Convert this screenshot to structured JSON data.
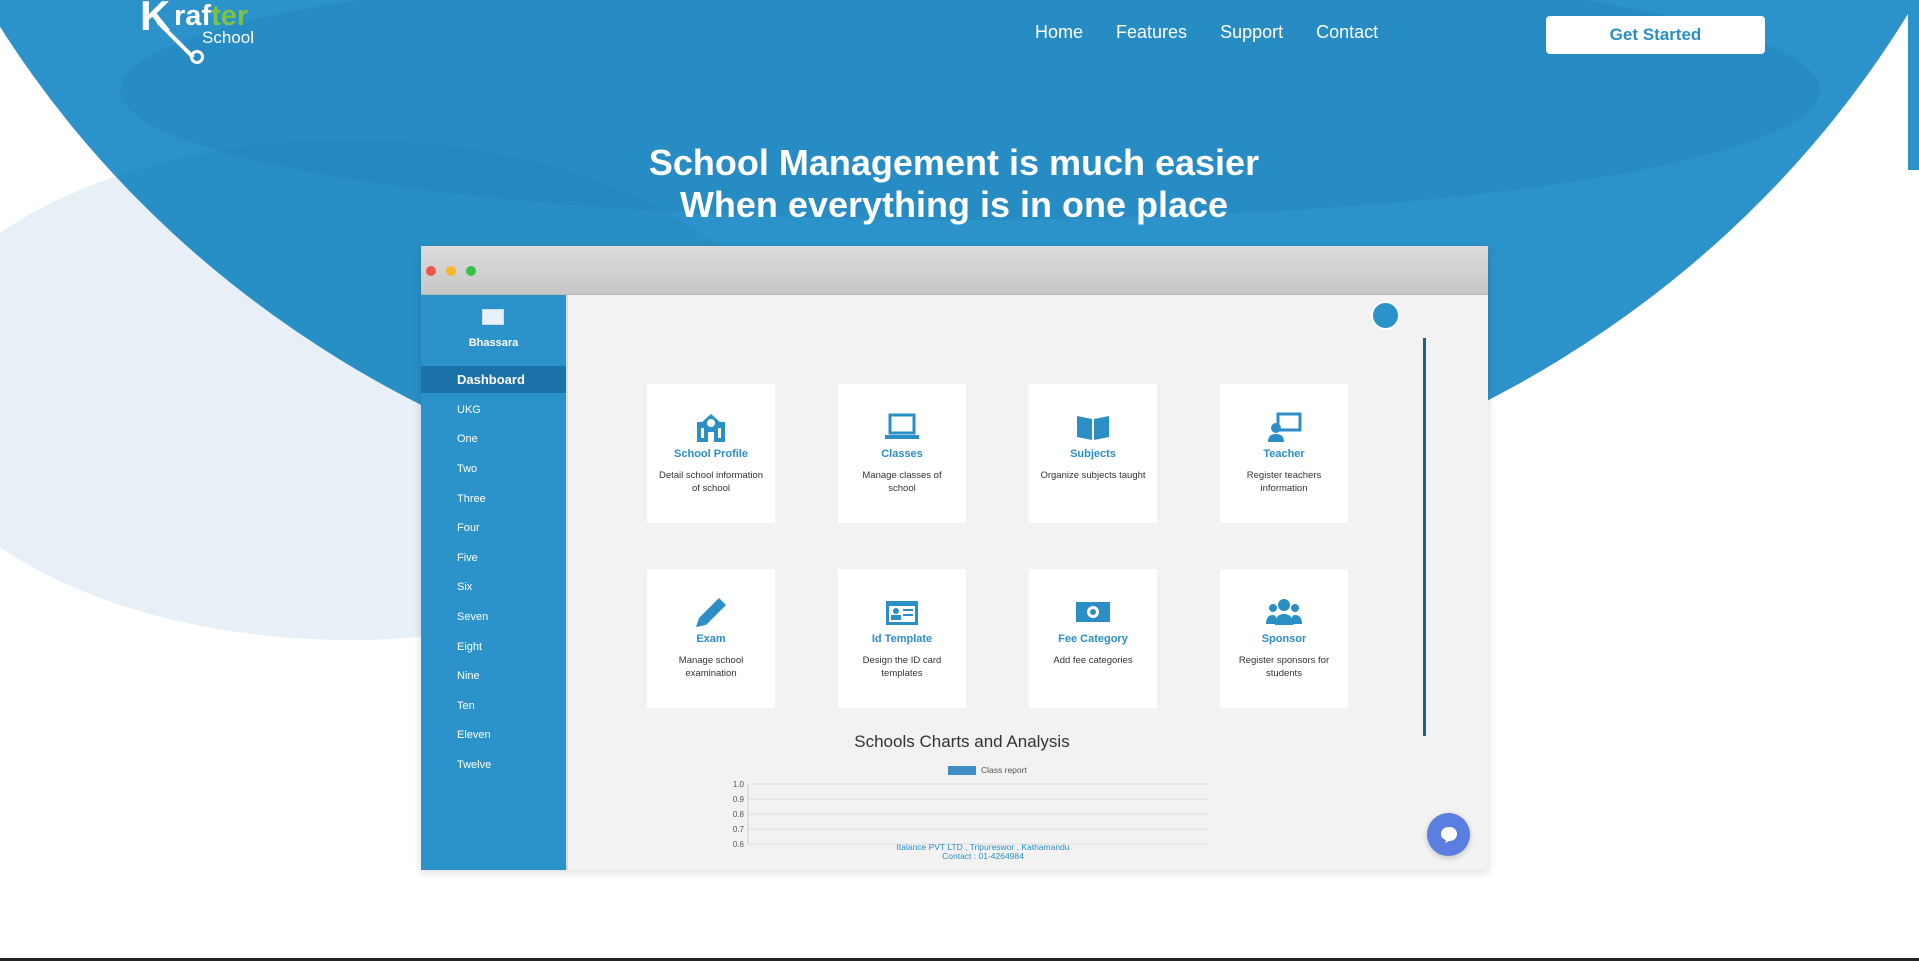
{
  "logo": {
    "k": "K",
    "rafter_white": "raf",
    "rafter_green": "ter",
    "school": "School"
  },
  "nav": {
    "links": [
      "Home",
      "Features",
      "Support",
      "Contact"
    ],
    "cta": "Get Started"
  },
  "headline": {
    "line1": "School Management is much easier",
    "line2": "When everything is in one place"
  },
  "app": {
    "school_name": "Bhassara",
    "menu": [
      "Dashboard",
      "UKG",
      "One",
      "Two",
      "Three",
      "Four",
      "Five",
      "Six",
      "Seven",
      "Eight",
      "Nine",
      "Ten",
      "Eleven",
      "Twelve"
    ],
    "cards": [
      {
        "title": "School Profile",
        "desc": "Detail school information of school",
        "icon": "school-icon"
      },
      {
        "title": "Classes",
        "desc": "Manage classes of school",
        "icon": "laptop-icon"
      },
      {
        "title": "Subjects",
        "desc": "Organize subjects taught",
        "icon": "book-icon"
      },
      {
        "title": "Teacher",
        "desc": "Register teachers information",
        "icon": "teacher-icon"
      },
      {
        "title": "Exam",
        "desc": "Manage school examination",
        "icon": "pencil-icon"
      },
      {
        "title": "Id Template",
        "desc": "Design the ID card templates",
        "icon": "id-card-icon"
      },
      {
        "title": "Fee Category",
        "desc": "Add fee categories",
        "icon": "money-icon"
      },
      {
        "title": "Sponsor",
        "desc": "Register sponsors for students",
        "icon": "users-icon"
      }
    ],
    "charts_title": "Schools Charts and Analysis",
    "footer_line1": "Italance PVT LTD , Tripureswor , Kathamandu",
    "footer_line2": "Contact : 01-4264984"
  },
  "chart_data": {
    "type": "bar",
    "series": [
      {
        "name": "Class report",
        "values": []
      }
    ],
    "yticks": [
      "1.0",
      "0.9",
      "0.8",
      "0.7",
      "0.6"
    ],
    "ylim": [
      0.6,
      1.0
    ],
    "color": "#3e8ec6"
  },
  "colors": {
    "brand_blue": "#2b93c9",
    "brand_green": "#7ec242"
  }
}
